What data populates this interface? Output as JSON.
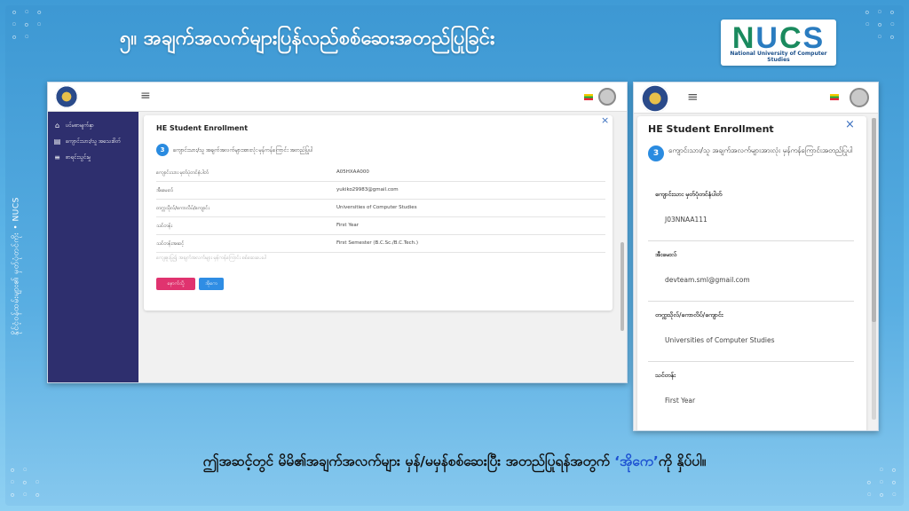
{
  "slide": {
    "title": "၅။ အချက်အလက်များပြန်လည်စစ်ဆေးအတည်ပြုခြင်း",
    "side_text": "နိုင်ငံ့ဝန်ထမ်းများ၏ မှတ်ပုံတင်ကိုး • NUCS",
    "caption_pre": "ဤအဆင့်တွင် မိမိ၏အချက်အလက်များ မှန်/မမှန်စစ်ဆေးပြီး အတည်ပြုရန်အတွက် ",
    "caption_highlight": "‘အိုကေ’",
    "caption_post": "ကို နှိပ်ပါ။",
    "colors": {
      "accent": "#1b4fd1",
      "background": "#4aa6dd"
    }
  },
  "logo": {
    "letters": [
      "N",
      "U",
      "C",
      "S"
    ],
    "subtitle": "National University of Computer Studies"
  },
  "desktop": {
    "sidebar": [
      {
        "icon": "home-icon",
        "glyph": "⌂",
        "label": "ပင်မစာမျက်နှာ"
      },
      {
        "icon": "enrollment-icon",
        "glyph": "▤",
        "label": "ကျောင်းသား/သူ အသေးစိတ်"
      },
      {
        "icon": "list-icon",
        "glyph": "≡",
        "label": "စာရင်းသွင်းမှု"
      }
    ],
    "card_title": "HE Student Enrollment",
    "step_number": "3",
    "step_text": "ကျောင်းသား/သူ အချက်အလက်များအားလုံး မှန်ကန်ကြောင်း အတည်ပြုပါ",
    "fields": [
      {
        "label": "ကျောင်းသား မှတ်ပုံတင်နံပါတ်",
        "value": "A05HXAA000"
      },
      {
        "label": "အီးမေးလ်",
        "value": "yukiko29983@gmail.com"
      },
      {
        "label": "တက္ကသိုလ်/ကောလိပ်/ကျောင်း",
        "value": "Universities of Computer Studies"
      },
      {
        "label": "သင်တန်း",
        "value": "First Year"
      },
      {
        "label": "သင်တန်းအဆင့်",
        "value": "First Semester (B.C.Sc./B.C.Tech.)"
      }
    ],
    "note": "ကျေးဇူးပြု၍ အချက်အလက်များ မှန်ကန်ကြောင်း စစ်ဆေးပေးပါ",
    "back_label": "နောက်သို့",
    "ok_label": "အိုကေ",
    "close_glyph": "×",
    "menu_glyph": "≡"
  },
  "mobile": {
    "card_title": "HE Student Enrollment",
    "step_number": "3",
    "step_text": "ကျောင်းသား/သူ အချက်အလက်များအားလုံး မှန်ကန်ကြောင်းအတည်ပြုပါ",
    "fields": [
      {
        "label": "ကျောင်းသား မှတ်ပုံတင်နံပါတ်",
        "value": "J03NNAA111"
      },
      {
        "label": "အီးမေးလ်",
        "value": "devteam.sml@gmail.com"
      },
      {
        "label": "တက္ကသိုလ်/ကောလိပ်/ကျောင်း",
        "value": "Universities of Computer Studies"
      },
      {
        "label": "သင်တန်း",
        "value": "First Year"
      }
    ],
    "close_glyph": "×",
    "menu_glyph": "≡"
  }
}
